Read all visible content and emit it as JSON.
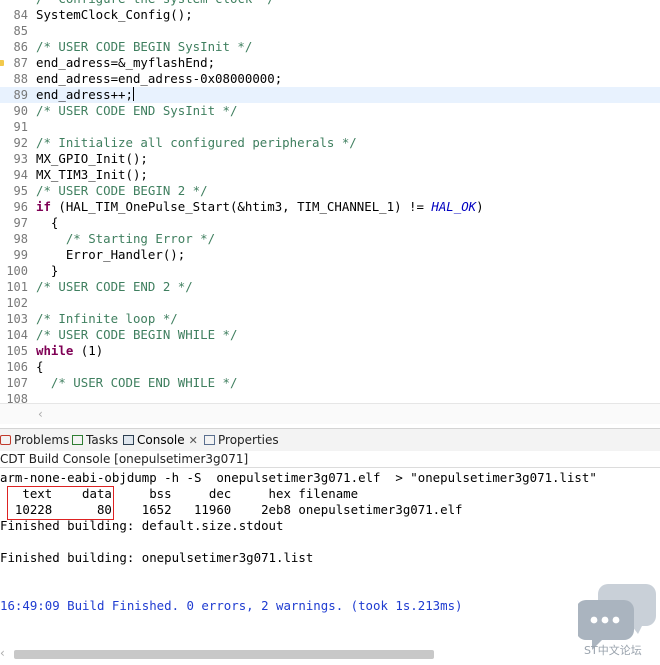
{
  "editor": {
    "lines": [
      {
        "n": "84",
        "code": "SystemClock_Config();"
      },
      {
        "n": "85",
        "code": ""
      },
      {
        "n": "86",
        "code": "/* USER CODE BEGIN SysInit */"
      },
      {
        "n": "87",
        "code": "end_adress=&_myflashEnd;"
      },
      {
        "n": "88",
        "code": "end_adress=end_adress-0x08000000;"
      },
      {
        "n": "89",
        "code": "end_adress++;"
      },
      {
        "n": "90",
        "code": "/* USER CODE END SysInit */"
      },
      {
        "n": "91",
        "code": ""
      },
      {
        "n": "92",
        "code": "/* Initialize all configured peripherals */"
      },
      {
        "n": "93",
        "code": "MX_GPIO_Init();"
      },
      {
        "n": "94",
        "code": "MX_TIM3_Init();"
      },
      {
        "n": "95",
        "code": "/* USER CODE BEGIN 2 */"
      },
      {
        "n": "96",
        "pre": "if",
        "mid": " (HAL_TIM_OnePulse_Start(&htim3, TIM_CHANNEL_1) != ",
        "macro": "HAL_OK",
        "post": ")"
      },
      {
        "n": "97",
        "code": "  {"
      },
      {
        "n": "98",
        "code": "    /* Starting Error */"
      },
      {
        "n": "99",
        "code": "    Error_Handler();"
      },
      {
        "n": "100",
        "code": "  }"
      },
      {
        "n": "101",
        "code": "/* USER CODE END 2 */"
      },
      {
        "n": "102",
        "code": ""
      },
      {
        "n": "103",
        "code": "/* Infinite loop */"
      },
      {
        "n": "104",
        "code": "/* USER CODE BEGIN WHILE */"
      },
      {
        "n": "105",
        "pre": "while",
        "post": " (1)"
      },
      {
        "n": "106",
        "code": "{"
      },
      {
        "n": "107",
        "code": "  /* USER CODE END WHILE */"
      },
      {
        "n": "108",
        "code": ""
      }
    ]
  },
  "tabs": {
    "problems": "Problems",
    "tasks": "Tasks",
    "console": "Console",
    "properties": "Properties"
  },
  "console": {
    "header": "CDT Build Console [onepulsetimer3g071]",
    "lines": [
      "arm-none-eabi-objdump -h -S  onepulsetimer3g071.elf  > \"onepulsetimer3g071.list\"",
      "   text    data     bss     dec     hex filename",
      "  10228      80    1652   11960    2eb8 onepulsetimer3g071.elf",
      "Finished building: default.size.stdout",
      "",
      "Finished building: onepulsetimer3g071.list",
      "",
      "",
      "16:49:09 Build Finished. 0 errors, 2 warnings. (took 1s.213ms)"
    ]
  },
  "watermark": {
    "text": "ST中文论坛"
  },
  "colors": {
    "comment": "#3f7f5f",
    "keyword": "#7f0055",
    "macro": "#0000c0",
    "build_finished": "#1f3cd1",
    "highlight_box": "#dd2222"
  }
}
